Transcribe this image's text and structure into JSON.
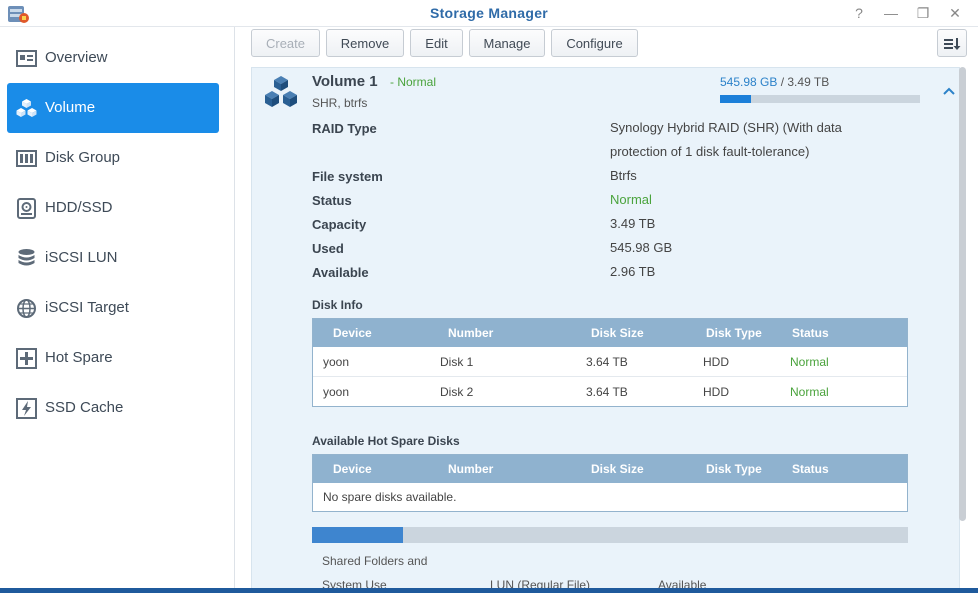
{
  "window": {
    "title": "Storage Manager",
    "controls": [
      "?",
      "—",
      "❐",
      "✕"
    ]
  },
  "sidebar": {
    "items": [
      {
        "label": "Overview",
        "icon": "overview-icon"
      },
      {
        "label": "Volume",
        "icon": "volume-icon",
        "active": true
      },
      {
        "label": "Disk Group",
        "icon": "disk-group-icon"
      },
      {
        "label": "HDD/SSD",
        "icon": "hdd-icon"
      },
      {
        "label": "iSCSI LUN",
        "icon": "iscsi-lun-icon"
      },
      {
        "label": "iSCSI Target",
        "icon": "iscsi-target-icon"
      },
      {
        "label": "Hot Spare",
        "icon": "hot-spare-icon"
      },
      {
        "label": "SSD Cache",
        "icon": "ssd-cache-icon"
      }
    ]
  },
  "toolbar": {
    "create": "Create",
    "remove": "Remove",
    "edit": "Edit",
    "manage": "Manage",
    "configure": "Configure",
    "sort_icon": "sort-icon"
  },
  "volume": {
    "name": "Volume 1",
    "status_suffix": "- Normal",
    "sub": "SHR, btrfs",
    "used": "545.98 GB",
    "total": "/ 3.49 TB",
    "usage_fraction": 0.156,
    "properties": [
      {
        "label": "RAID Type",
        "value": "Synology Hybrid RAID (SHR) (With data protection of 1 disk fault-tolerance)"
      },
      {
        "label": "File system",
        "value": "Btrfs"
      },
      {
        "label": "Status",
        "value": "Normal"
      },
      {
        "label": "Capacity",
        "value": "3.49 TB"
      },
      {
        "label": "Used",
        "value": "545.98 GB"
      },
      {
        "label": "Available",
        "value": "2.96 TB"
      }
    ]
  },
  "disk_info": {
    "title": "Disk Info",
    "columns": [
      "Device",
      "Number",
      "Disk Size",
      "Disk Type",
      "Status"
    ],
    "rows": [
      [
        "yoon",
        "Disk 1",
        "3.64 TB",
        "HDD",
        "Normal"
      ],
      [
        "yoon",
        "Disk 2",
        "3.64 TB",
        "HDD",
        "Normal"
      ]
    ]
  },
  "hot_spare": {
    "title": "Available Hot Spare Disks",
    "columns": [
      "Device",
      "Number",
      "Disk Size",
      "Disk Type",
      "Status"
    ],
    "empty": "No spare disks available."
  },
  "allocation": {
    "shared_line1": "Shared Folders and",
    "shared_line2": "System Use",
    "lun": "LUN (Regular File)",
    "available": "Available"
  },
  "colors": {
    "accent": "#1a8ce8",
    "normal": "#4aa33c",
    "table_header": "#8fb2cf"
  }
}
